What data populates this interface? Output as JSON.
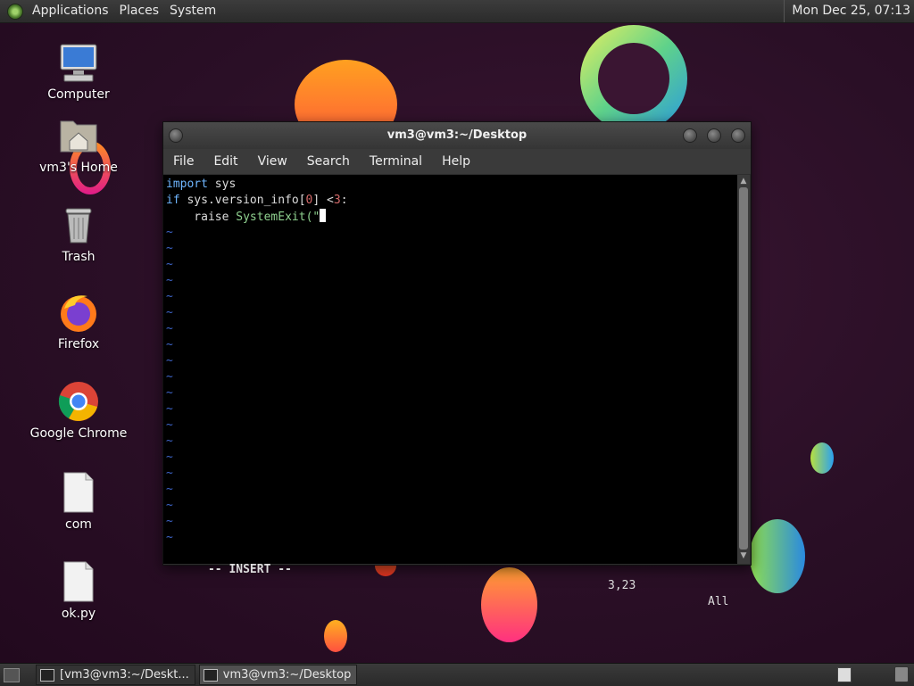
{
  "top_panel": {
    "menus": [
      "Applications",
      "Places",
      "System"
    ],
    "clock": "Mon Dec 25, 07:13"
  },
  "desktop_icons": [
    {
      "label": "Computer",
      "icon": "computer-icon"
    },
    {
      "label": "vm3's Home",
      "icon": "home-folder-icon"
    },
    {
      "label": "Trash",
      "icon": "trash-icon"
    },
    {
      "label": "Firefox",
      "icon": "firefox-icon"
    },
    {
      "label": "Google Chrome",
      "icon": "chrome-icon"
    },
    {
      "label": "com",
      "icon": "file-icon"
    },
    {
      "label": "ok.py",
      "icon": "file-icon"
    }
  ],
  "terminal": {
    "title": "vm3@vm3:~/Desktop",
    "menus": [
      "File",
      "Edit",
      "View",
      "Search",
      "Terminal",
      "Help"
    ],
    "code": {
      "l1_kw": "import",
      "l1_rest": " sys",
      "l2_kw": "if",
      "l2_a": " sys.version_info[",
      "l2_num": "0",
      "l2_b": "] <",
      "l2_num2": "3",
      "l2_c": ":",
      "l3_a": "    raise ",
      "l3_fn": "SystemExit",
      "l3_b": "(\""
    },
    "tilde": "~",
    "mode": "-- INSERT --",
    "position": "3,23",
    "scroll": "All"
  },
  "taskbar": {
    "tasks": [
      "[vm3@vm3:~/Deskt...",
      "vm3@vm3:~/Desktop"
    ]
  },
  "colors": {
    "keyword": "#6fb6ff",
    "number": "#d46a6a",
    "function": "#8fd18f",
    "tilde": "#3d64c8"
  }
}
